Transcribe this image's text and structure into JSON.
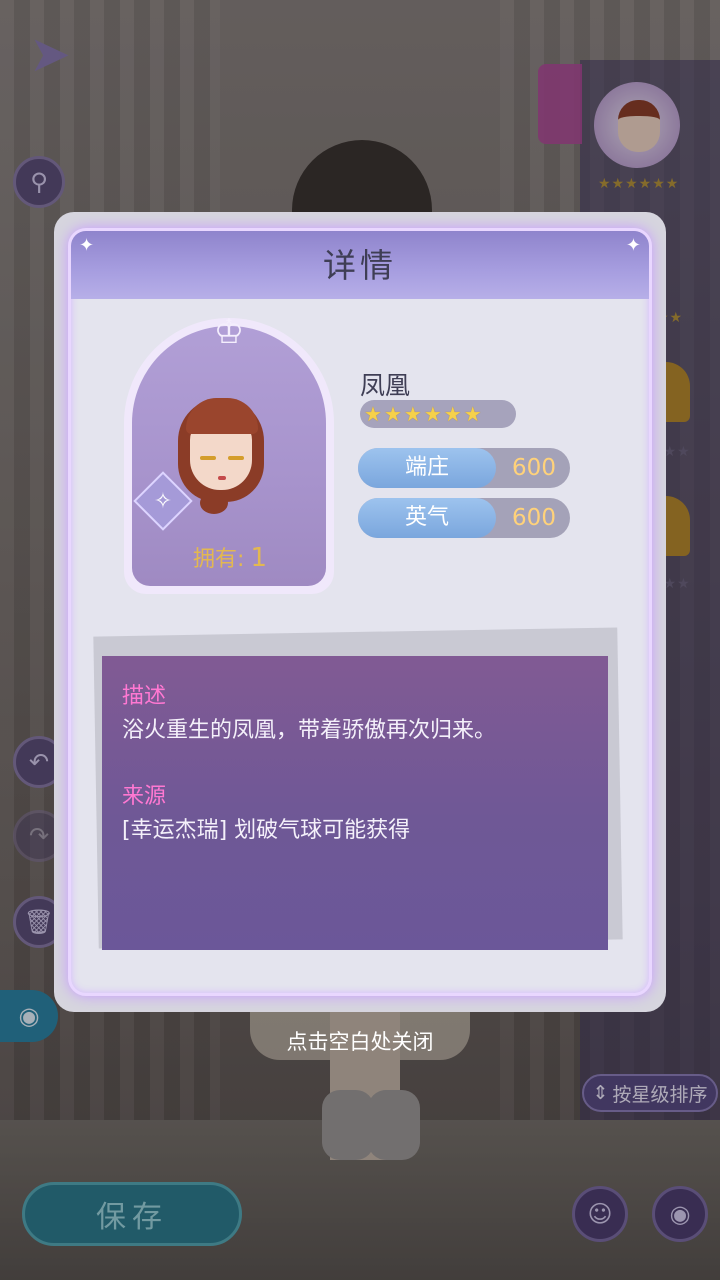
{
  "modal": {
    "title": "详情",
    "item": {
      "name": "凤凰",
      "stars": 6,
      "owned_label": "拥有:",
      "owned_count": "1",
      "stats": [
        {
          "label": "端庄",
          "value": "600"
        },
        {
          "label": "英气",
          "value": "600"
        }
      ]
    },
    "description": {
      "heading": "描述",
      "text": "浴火重生的凤凰，带着骄傲再次归来。",
      "source_heading": "来源",
      "source_text": "[幸运杰瑞] 划破气球可能获得"
    }
  },
  "close_hint": "点击空白处关闭",
  "bottom_bar": {
    "save_label": "保存",
    "sort_label": "按星级排序"
  },
  "icons": {
    "back": "back-arrow-icon",
    "search": "search-icon",
    "undo": "undo-icon",
    "redo": "redo-icon",
    "delete": "trash-icon",
    "camera": "camera-icon",
    "wand": "magic-wand-icon",
    "profile": "person-icon",
    "eye": "eye-icon",
    "sort": "sort-arrows-icon"
  },
  "colors": {
    "header_bg": "#a79ee0",
    "stat_label_bg": "#7aa6dd",
    "stat_value": "#ffd27a",
    "desc_heading": "#ff78d2",
    "save_btn": "#2f7d91"
  }
}
